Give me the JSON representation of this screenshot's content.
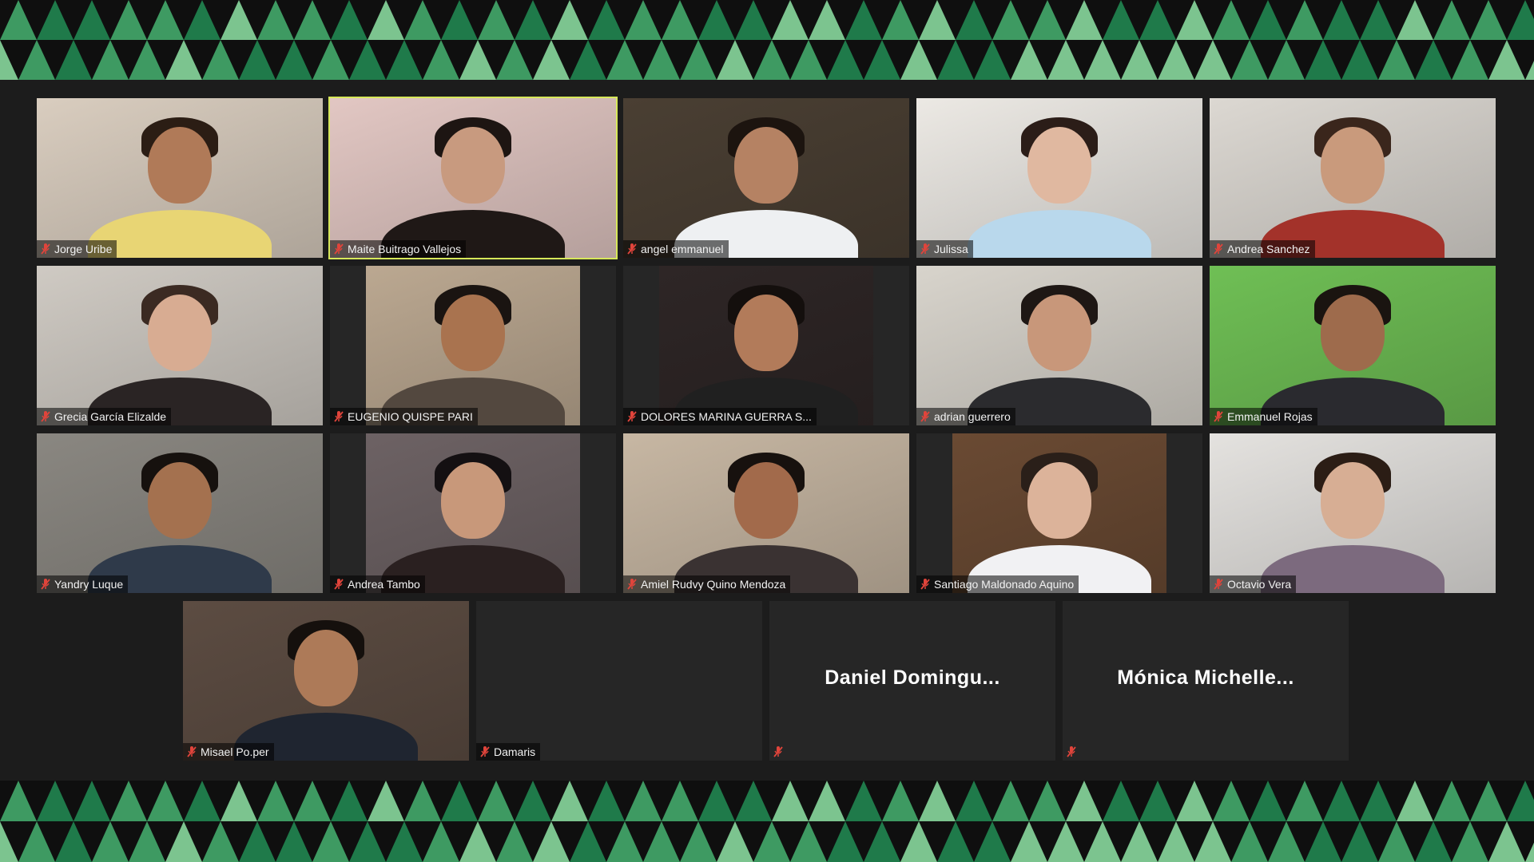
{
  "meeting": {
    "tiles": [
      {
        "name": "Jorge Uribe",
        "video": true,
        "pillarbox": false,
        "active": false,
        "colors": {
          "bg": "#d9cdbf",
          "skin": "#b07a58",
          "hair": "#2b1d14",
          "shirt": "#e8d574"
        }
      },
      {
        "name": "Maite Buitrago Vallejos",
        "video": true,
        "pillarbox": false,
        "active": true,
        "colors": {
          "bg": "#e2c7c3",
          "skin": "#c89a7f",
          "hair": "#1d1512",
          "shirt": "#1f1816"
        }
      },
      {
        "name": "angel emmanuel",
        "video": true,
        "pillarbox": false,
        "active": false,
        "colors": {
          "bg": "#4a3f33",
          "skin": "#b58263",
          "hair": "#1c140f",
          "shirt": "#eef0f2"
        }
      },
      {
        "name": "Julissa",
        "video": true,
        "pillarbox": false,
        "active": false,
        "colors": {
          "bg": "#ece9e4",
          "skin": "#e0b8a0",
          "hair": "#2b1d18",
          "shirt": "#b9d8ec"
        }
      },
      {
        "name": "Andrea Sanchez",
        "video": true,
        "pillarbox": false,
        "active": false,
        "colors": {
          "bg": "#dcd8d2",
          "skin": "#c99a7c",
          "hair": "#3a261c",
          "shirt": "#a3322a"
        }
      },
      {
        "name": "Grecia García Elizalde",
        "video": true,
        "pillarbox": false,
        "active": false,
        "colors": {
          "bg": "#cfcac3",
          "skin": "#d8ac92",
          "hair": "#3b2a22",
          "shirt": "#2a2424"
        }
      },
      {
        "name": "EUGENIO QUISPE PARI",
        "video": true,
        "pillarbox": true,
        "active": false,
        "colors": {
          "bg": "#bba891",
          "skin": "#a9734f",
          "hair": "#1a1411",
          "shirt": "#53483f"
        }
      },
      {
        "name": "DOLORES MARINA GUERRA S...",
        "video": true,
        "pillarbox": true,
        "active": false,
        "colors": {
          "bg": "#2e2626",
          "skin": "#b27b5a",
          "hair": "#140f0d",
          "shirt": "#202020"
        }
      },
      {
        "name": "adrian guerrero",
        "video": true,
        "pillarbox": false,
        "active": false,
        "colors": {
          "bg": "#d8d4cc",
          "skin": "#c8977a",
          "hair": "#1e1714",
          "shirt": "#2b2b2e"
        }
      },
      {
        "name": "Emmanuel Rojas",
        "video": true,
        "pillarbox": false,
        "active": false,
        "colors": {
          "bg": "#6fbf55",
          "skin": "#9e6b4c",
          "hair": "#1a1410",
          "shirt": "#2a2a2f"
        }
      },
      {
        "name": "Yandry Luque",
        "video": true,
        "pillarbox": false,
        "active": false,
        "colors": {
          "bg": "#8a8781",
          "skin": "#a4714f",
          "hair": "#16110e",
          "shirt": "#2f3a4a"
        }
      },
      {
        "name": "Andrea Tambo",
        "video": true,
        "pillarbox": true,
        "active": false,
        "colors": {
          "bg": "#6d6264",
          "skin": "#c8987a",
          "hair": "#141012",
          "shirt": "#2a2020"
        }
      },
      {
        "name": "Amiel Rudvy Quino Mendoza",
        "video": true,
        "pillarbox": false,
        "active": false,
        "colors": {
          "bg": "#c7b7a3",
          "skin": "#a26a4b",
          "hair": "#17110e",
          "shirt": "#3a3232"
        }
      },
      {
        "name": "Santiago Maldonado Aquino",
        "video": true,
        "pillarbox": true,
        "active": false,
        "colors": {
          "bg": "#6a4a33",
          "skin": "#dcb39a",
          "hair": "#2a1f19",
          "shirt": "#f1f1f3"
        }
      },
      {
        "name": "Octavio Vera",
        "video": true,
        "pillarbox": false,
        "active": false,
        "colors": {
          "bg": "#e4e2df",
          "skin": "#d7ae94",
          "hair": "#2b1d15",
          "shirt": "#7c6a7e"
        }
      },
      {
        "name": "Misael Po.per",
        "video": true,
        "pillarbox": false,
        "active": false,
        "colors": {
          "bg": "#5c4c42",
          "skin": "#ad7a58",
          "hair": "#15100d",
          "shirt": "#1f2530"
        }
      },
      {
        "name": "Damaris",
        "video": false,
        "pillarbox": false,
        "active": false,
        "display_name": "",
        "colors": {
          "bg": "#262626"
        }
      },
      {
        "name": "",
        "video": false,
        "pillarbox": false,
        "active": false,
        "display_name": "Daniel  Domingu...",
        "colors": {
          "bg": "#262626"
        }
      },
      {
        "name": "",
        "video": false,
        "pillarbox": false,
        "active": false,
        "display_name": "Mónica  Michelle...",
        "colors": {
          "bg": "#262626"
        }
      }
    ],
    "colors": {
      "background": "#1c1c1c",
      "active_speaker": "#d7e85a",
      "mic_muted": "#e0443b",
      "pattern": [
        "#1f7a4a",
        "#3e9a62",
        "#7cc48f",
        "#0f0f0f"
      ]
    },
    "icons": {
      "mic": "mic-muted-icon"
    }
  }
}
